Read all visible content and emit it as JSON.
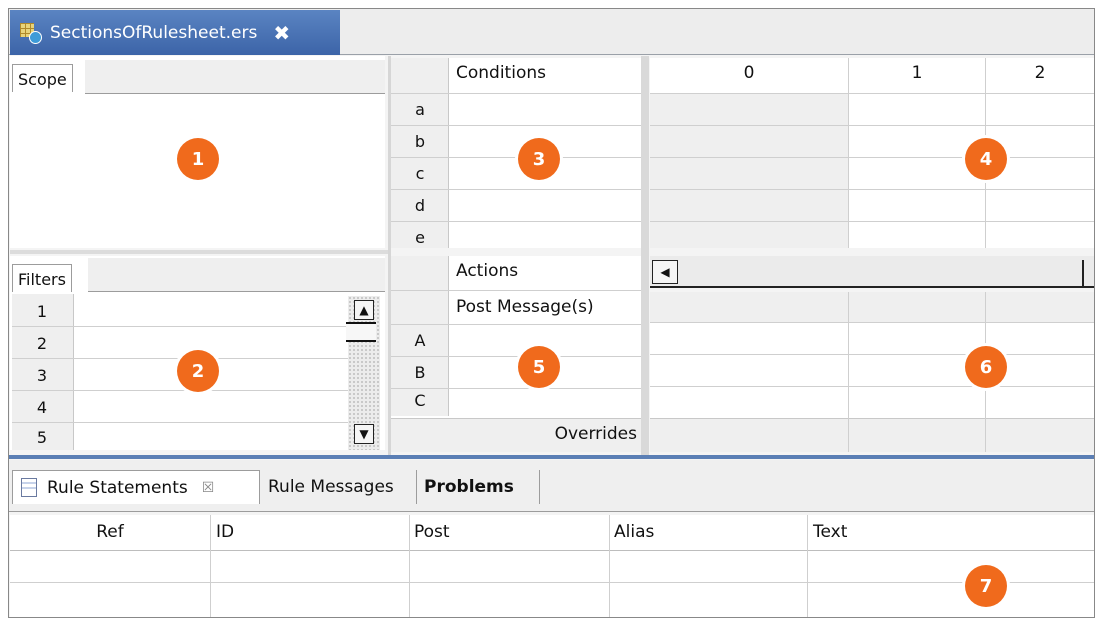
{
  "editor": {
    "tab_title": "SectionsOfRulesheet.ers",
    "close_glyph": "✖",
    "icon": "rulesheet-icon"
  },
  "scope": {
    "tab_label": "Scope",
    "badge": "1"
  },
  "filters": {
    "tab_label": "Filters",
    "rows": [
      "1",
      "2",
      "3",
      "4",
      "5"
    ],
    "badge": "2"
  },
  "conditions": {
    "header": "Conditions",
    "rows": [
      "a",
      "b",
      "c",
      "d",
      "e"
    ],
    "badge": "3"
  },
  "columns": {
    "headers": [
      "0",
      "1",
      "2"
    ],
    "badge": "4"
  },
  "actions": {
    "header": "Actions",
    "post_message": "Post Message(s)",
    "rows": [
      "A",
      "B",
      "C"
    ],
    "overrides": "Overrides",
    "badge": "5"
  },
  "action_grid": {
    "badge": "6"
  },
  "bottom": {
    "tabs": [
      "Rule Statements",
      "Rule Messages",
      "Problems"
    ],
    "close_glyph": "☒",
    "table_headers": [
      "Ref",
      "ID",
      "Post",
      "Alias",
      "Text"
    ],
    "badge": "7"
  },
  "colors": {
    "accent": "#f06a1c",
    "tab_blue": "#4a74b8"
  }
}
